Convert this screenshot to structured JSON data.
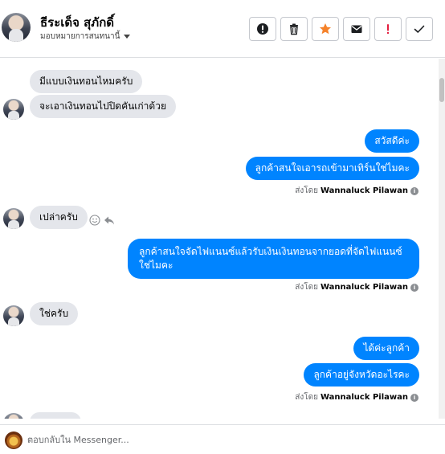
{
  "header": {
    "contact_name": "ธีระเด็จ สุภักดิ์",
    "assignment_label": "มอบหมายการสนทนานี้",
    "avatar_icon": "profile-photo",
    "actions": [
      {
        "name": "mark-spam",
        "icon": "alert-circle-icon"
      },
      {
        "name": "delete",
        "icon": "trash-icon"
      },
      {
        "name": "star",
        "icon": "star-icon",
        "color": "#f5822a"
      },
      {
        "name": "mark-unread",
        "icon": "envelope-icon"
      },
      {
        "name": "follow-up",
        "icon": "exclamation-icon",
        "color": "#e41e3f"
      },
      {
        "name": "mark-done",
        "icon": "check-icon"
      }
    ]
  },
  "messages": [
    {
      "direction": "in",
      "text": "มีแบบเงินทอนไหมครับ"
    },
    {
      "direction": "in",
      "text": "จะเอาเงินทอนไปปิดคันเก่าด้วย"
    },
    {
      "direction": "out",
      "text": "สวัสดีค่ะ"
    },
    {
      "direction": "out",
      "text": "ลูกค้าสนใจเอารถเข้ามาเทิร์นใช่ไมคะ"
    },
    {
      "direction": "in",
      "text": "เปล่าครับ"
    },
    {
      "direction": "out",
      "text": "ลูกค้าสนใจจัดไฟแนนซ์แล้วรับเงินเงินทอนจากยอดที่จัดไฟแนนซ์ใช่ไมคะ"
    },
    {
      "direction": "in",
      "text": "ใช่ครับ"
    },
    {
      "direction": "out",
      "text": "ได้ค่ะลูกค้า"
    },
    {
      "direction": "out",
      "text": "ลูกค้าอยู่จังหวัดอะไรคะ"
    }
  ],
  "sent_by": {
    "prefix": "ส่งโดย",
    "agent_name": "Wannaluck Pilawan",
    "info_symbol": "i"
  },
  "composer": {
    "placeholder": "ตอบกลับใน Messenger..."
  },
  "colors": {
    "outgoing_bubble": "#0084ff",
    "incoming_bubble": "#e4e6eb",
    "star": "#f5822a",
    "alert": "#e41e3f"
  }
}
